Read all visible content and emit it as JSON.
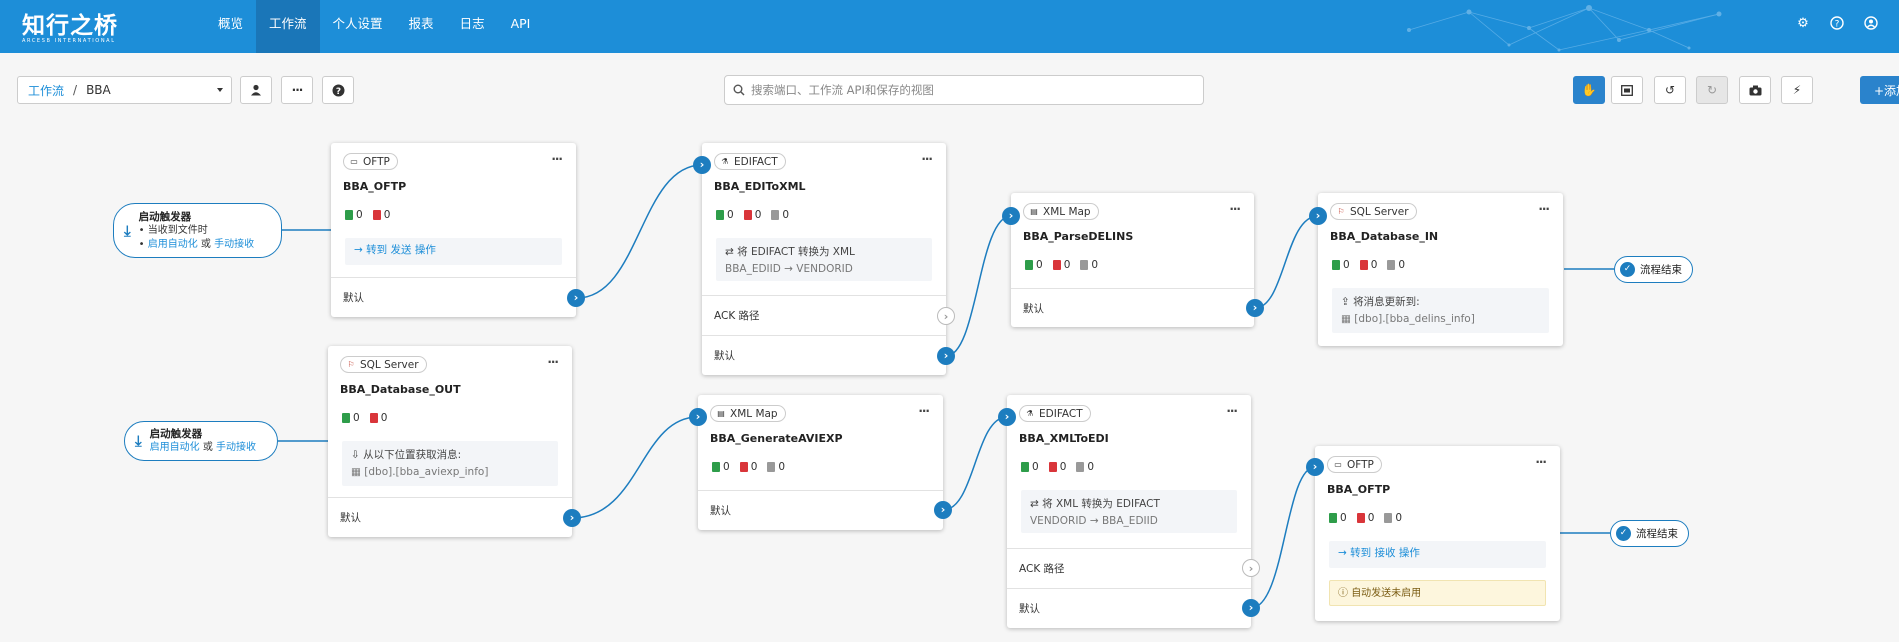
{
  "app": {
    "logo_cn": "知行之桥",
    "logo_en": "ARCESB INTERNATIONAL",
    "nav": [
      "概览",
      "工作流",
      "个人设置",
      "报表",
      "日志",
      "API"
    ],
    "active_nav": "工作流"
  },
  "toolbar": {
    "crumb_root": "工作流",
    "crumb_sep": "/",
    "crumb_current": "BBA",
    "search_placeholder": "搜索端口、工作流 API和保存的视图",
    "add_label": "+添加"
  },
  "colors": {
    "brand": "#1d8ed8",
    "port": "#1d7dbf",
    "nav_active": "#1a76b8"
  },
  "triggers": [
    {
      "title": "启动触发器",
      "line1": "当收到文件时",
      "enable": "启用自动化",
      "or": "或",
      "manual": "手动接收"
    },
    {
      "title": "启动触发器",
      "enable": "启用自动化",
      "or": "或",
      "manual": "手动接收"
    }
  ],
  "ends": [
    "流程结束",
    "流程结束"
  ],
  "cards": {
    "oftp1": {
      "type": "OFTP",
      "name": "BBA_OFTP",
      "ok": "0",
      "err": "0",
      "action_arrow": "→",
      "action_text": "转到 发送 操作",
      "port": "默认"
    },
    "edi1": {
      "type": "EDIFACT",
      "name": "BBA_EDIToXML",
      "ok": "0",
      "err": "0",
      "pend": "0",
      "info1": "⇄ 将 EDIFACT 转换为 XML",
      "info2": "BBA_EDIID → VENDORID",
      "ack": "ACK 路径",
      "port": "默认"
    },
    "xml1": {
      "type": "XML Map",
      "name": "BBA_ParseDELINS",
      "ok": "0",
      "err": "0",
      "pend": "0",
      "port": "默认"
    },
    "sql1": {
      "type": "SQL Server",
      "name": "BBA_Database_IN",
      "ok": "0",
      "err": "0",
      "pend": "0",
      "info1": "将消息更新到:",
      "info2": "[dbo].[bba_delins_info]"
    },
    "sql2": {
      "type": "SQL Server",
      "name": "BBA_Database_OUT",
      "ok": "0",
      "err": "0",
      "info1": "从以下位置获取消息:",
      "info2": "[dbo].[bba_aviexp_info]",
      "port": "默认"
    },
    "xml2": {
      "type": "XML Map",
      "name": "BBA_GenerateAVIEXP",
      "ok": "0",
      "err": "0",
      "pend": "0",
      "port": "默认"
    },
    "edi2": {
      "type": "EDIFACT",
      "name": "BBA_XMLToEDI",
      "ok": "0",
      "err": "0",
      "pend": "0",
      "info1": "⇄ 将 XML 转换为 EDIFACT",
      "info2": "VENDORID → BBA_EDIID",
      "ack": "ACK 路径",
      "port": "默认"
    },
    "oftp2": {
      "type": "OFTP",
      "name": "BBA_OFTP",
      "ok": "0",
      "err": "0",
      "pend": "0",
      "action_arrow": "→",
      "action_text": "转到 接收 操作",
      "warn": "自动发送未启用"
    }
  }
}
